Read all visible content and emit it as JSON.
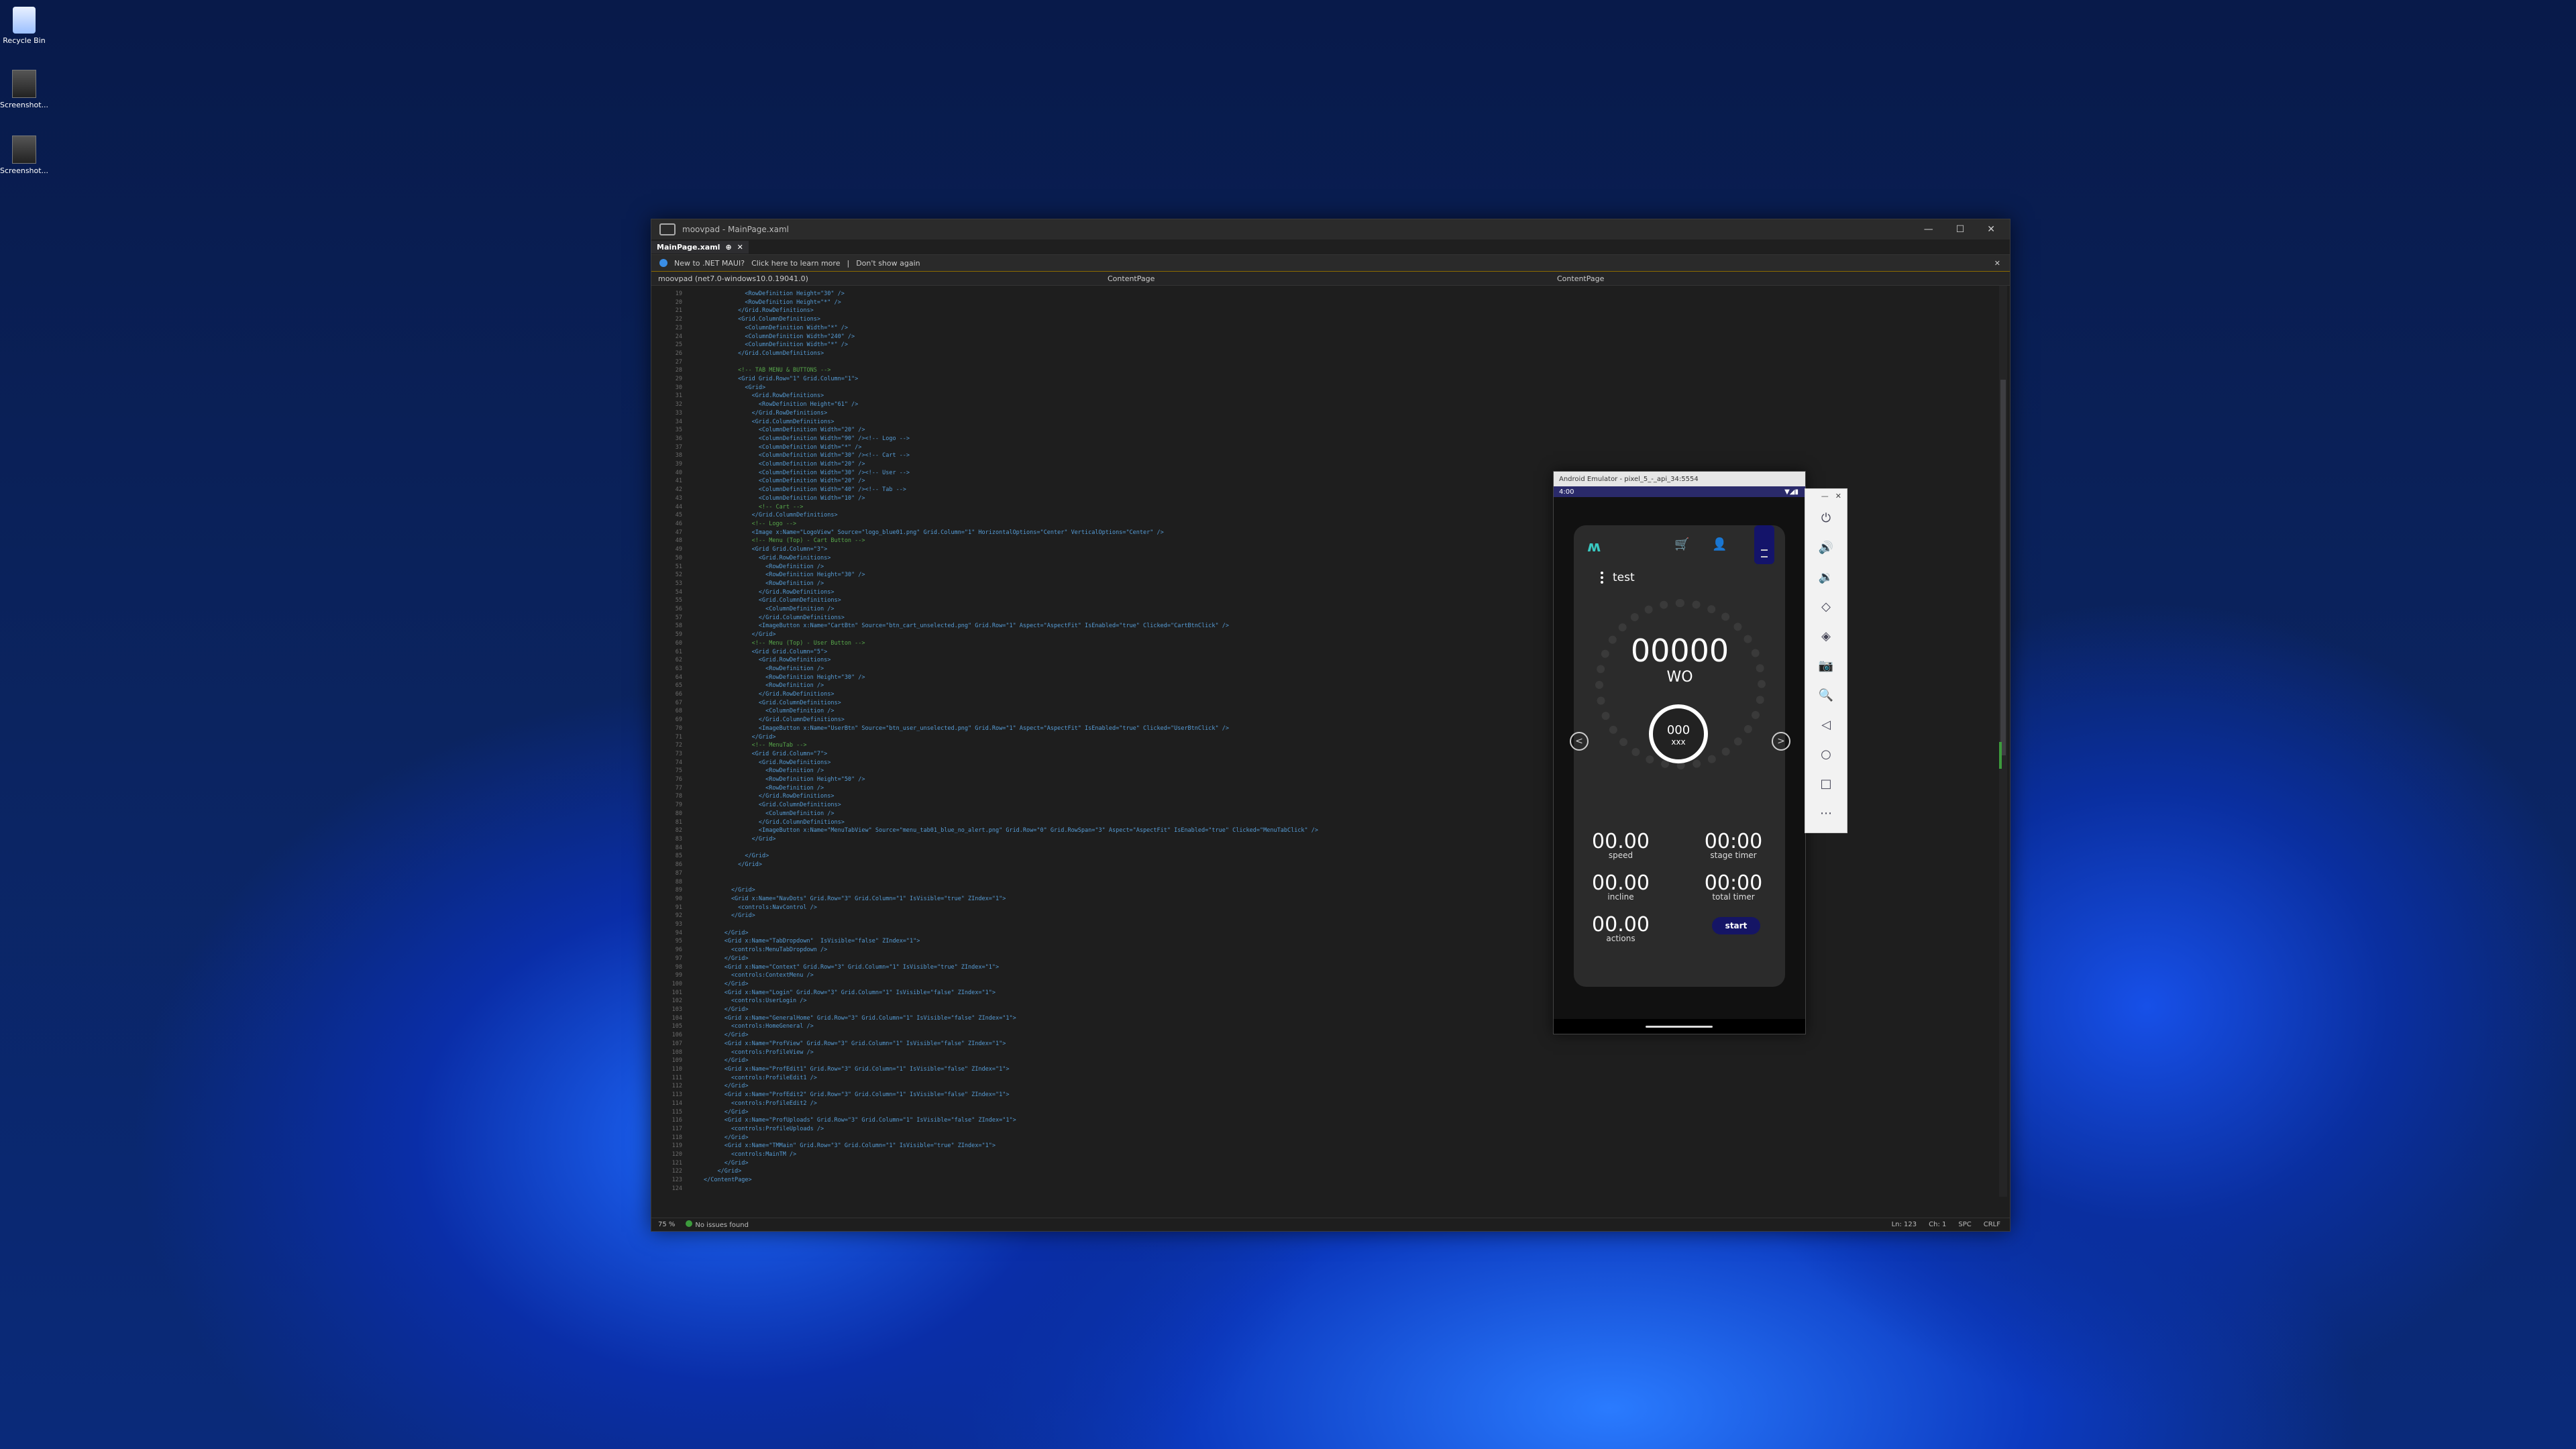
{
  "desktop": {
    "icons": [
      {
        "label": "Recycle Bin"
      },
      {
        "label": "Screenshot..."
      },
      {
        "label": "Screenshot..."
      }
    ]
  },
  "vs": {
    "window_title": "moovpad - MainPage.xaml",
    "tab_label": "MainPage.xaml",
    "tab_pin": "⊕",
    "tab_close": "✕",
    "info_text": "New to .NET MAUI?",
    "info_link": "Click here to learn more",
    "info_sep": "|",
    "info_dismiss": "Don't show again",
    "nav_project": "moovpad (net7.0-windows10.0.19041.0)",
    "nav_class": "ContentPage",
    "nav_member": "ContentPage",
    "zoom": "75 %",
    "issues": "No issues found",
    "ln": "Ln: 123",
    "ch": "Ch: 1",
    "spc": "SPC",
    "crlf": "CRLF",
    "line_numbers": [
      "19",
      "20",
      "21",
      "22",
      "23",
      "24",
      "25",
      "26",
      "27",
      "28",
      "29",
      "30",
      "31",
      "32",
      "33",
      "34",
      "35",
      "36",
      "37",
      "38",
      "39",
      "40",
      "41",
      "42",
      "43",
      "44",
      "45",
      "46",
      "47",
      "48",
      "49",
      "50",
      "51",
      "52",
      "53",
      "54",
      "55",
      "56",
      "57",
      "58",
      "59",
      "60",
      "61",
      "62",
      "63",
      "64",
      "65",
      "66",
      "67",
      "68",
      "69",
      "70",
      "71",
      "72",
      "73",
      "74",
      "75",
      "76",
      "77",
      "78",
      "79",
      "80",
      "81",
      "82",
      "83",
      "84",
      "85",
      "86",
      "87",
      "88",
      "89",
      "90",
      "91",
      "92",
      "93",
      "94",
      "95",
      "96",
      "97",
      "98",
      "99",
      "100",
      "101",
      "102",
      "103",
      "104",
      "105",
      "106",
      "107",
      "108",
      "109",
      "110",
      "111",
      "112",
      "113",
      "114",
      "115",
      "116",
      "117",
      "118",
      "119",
      "120",
      "121",
      "122",
      "123",
      "124"
    ],
    "code_lines": [
      "            <RowDefinition Height=\"30\" />",
      "            <RowDefinition Height=\"*\" />",
      "          </Grid.RowDefinitions>",
      "          <Grid.ColumnDefinitions>",
      "            <ColumnDefinition Width=\"*\" />",
      "            <ColumnDefinition Width=\"240\" />",
      "            <ColumnDefinition Width=\"*\" />",
      "          </Grid.ColumnDefinitions>",
      "",
      "          <!-- TAB MENU & BUTTONS -->",
      "          <Grid Grid.Row=\"1\" Grid.Column=\"1\">",
      "            <Grid>",
      "              <Grid.RowDefinitions>",
      "                <RowDefinition Height=\"61\" />",
      "              </Grid.RowDefinitions>",
      "              <Grid.ColumnDefinitions>",
      "                <ColumnDefinition Width=\"20\" />",
      "                <ColumnDefinition Width=\"90\" /><!-- Logo -->",
      "                <ColumnDefinition Width=\"*\" />",
      "                <ColumnDefinition Width=\"30\" /><!-- Cart -->",
      "                <ColumnDefinition Width=\"20\" />",
      "                <ColumnDefinition Width=\"30\" /><!-- User -->",
      "                <ColumnDefinition Width=\"20\" />",
      "                <ColumnDefinition Width=\"40\" /><!-- Tab -->",
      "                <ColumnDefinition Width=\"10\" />",
      "                <!-- Cart -->",
      "              </Grid.ColumnDefinitions>",
      "              <!-- Logo -->",
      "              <Image x:Name=\"LogoView\" Source=\"logo_blue01.png\" Grid.Column=\"1\" HorizontalOptions=\"Center\" VerticalOptions=\"Center\" />",
      "              <!-- Menu (Top) - Cart Button -->",
      "              <Grid Grid.Column=\"3\">",
      "                <Grid.RowDefinitions>",
      "                  <RowDefinition />",
      "                  <RowDefinition Height=\"30\" />",
      "                  <RowDefinition />",
      "                </Grid.RowDefinitions>",
      "                <Grid.ColumnDefinitions>",
      "                  <ColumnDefinition />",
      "                </Grid.ColumnDefinitions>",
      "                <ImageButton x:Name=\"CartBtn\" Source=\"btn_cart_unselected.png\" Grid.Row=\"1\" Aspect=\"AspectFit\" IsEnabled=\"true\" Clicked=\"CartBtnClick\" />",
      "              </Grid>",
      "              <!-- Menu (Top) - User Button -->",
      "              <Grid Grid.Column=\"5\">",
      "                <Grid.RowDefinitions>",
      "                  <RowDefinition />",
      "                  <RowDefinition Height=\"30\" />",
      "                  <RowDefinition />",
      "                </Grid.RowDefinitions>",
      "                <Grid.ColumnDefinitions>",
      "                  <ColumnDefinition />",
      "                </Grid.ColumnDefinitions>",
      "                <ImageButton x:Name=\"UserBtn\" Source=\"btn_user_unselected.png\" Grid.Row=\"1\" Aspect=\"AspectFit\" IsEnabled=\"true\" Clicked=\"UserBtnClick\" />",
      "              </Grid>",
      "              <!-- MenuTab -->",
      "              <Grid Grid.Column=\"7\">",
      "                <Grid.RowDefinitions>",
      "                  <RowDefinition />",
      "                  <RowDefinition Height=\"50\" />",
      "                  <RowDefinition />",
      "                </Grid.RowDefinitions>",
      "                <Grid.ColumnDefinitions>",
      "                  <ColumnDefinition />",
      "                </Grid.ColumnDefinitions>",
      "                <ImageButton x:Name=\"MenuTabView\" Source=\"menu_tab01_blue_no_alert.png\" Grid.Row=\"0\" Grid.RowSpan=\"3\" Aspect=\"AspectFit\" IsEnabled=\"true\" Clicked=\"MenuTabClick\" />",
      "              </Grid>",
      "",
      "            </Grid>",
      "          </Grid>",
      "",
      "",
      "        </Grid>",
      "        <Grid x:Name=\"NavDots\" Grid.Row=\"3\" Grid.Column=\"1\" IsVisible=\"true\" ZIndex=\"1\">",
      "          <controls:NavControl />",
      "        </Grid>",
      "",
      "      </Grid>",
      "      <Grid x:Name=\"TabDropdown\"  IsVisible=\"false\" ZIndex=\"1\">",
      "        <controls:MenuTabDropdown />",
      "      </Grid>",
      "      <Grid x:Name=\"Context\" Grid.Row=\"3\" Grid.Column=\"1\" IsVisible=\"true\" ZIndex=\"1\">",
      "        <controls:ContextMenu />",
      "      </Grid>",
      "      <Grid x:Name=\"Login\" Grid.Row=\"3\" Grid.Column=\"1\" IsVisible=\"false\" ZIndex=\"1\">",
      "        <controls:UserLogin />",
      "      </Grid>",
      "      <Grid x:Name=\"GeneralHome\" Grid.Row=\"3\" Grid.Column=\"1\" IsVisible=\"false\" ZIndex=\"1\">",
      "        <controls:HomeGeneral />",
      "      </Grid>",
      "      <Grid x:Name=\"ProfView\" Grid.Row=\"3\" Grid.Column=\"1\" IsVisible=\"false\" ZIndex=\"1\">",
      "        <controls:ProfileView />",
      "      </Grid>",
      "      <Grid x:Name=\"ProfEdit1\" Grid.Row=\"3\" Grid.Column=\"1\" IsVisible=\"false\" ZIndex=\"1\">",
      "        <controls:ProfileEdit1 />",
      "      </Grid>",
      "      <Grid x:Name=\"ProfEdit2\" Grid.Row=\"3\" Grid.Column=\"1\" IsVisible=\"false\" ZIndex=\"1\">",
      "        <controls:ProfileEdit2 />",
      "      </Grid>",
      "      <Grid x:Name=\"ProfUploads\" Grid.Row=\"3\" Grid.Column=\"1\" IsVisible=\"false\" ZIndex=\"1\">",
      "        <controls:ProfileUploads />",
      "      </Grid>",
      "      <Grid x:Name=\"TMMain\" Grid.Row=\"3\" Grid.Column=\"1\" IsVisible=\"true\" ZIndex=\"1\">",
      "        <controls:MainTM />",
      "      </Grid>",
      "    </Grid>",
      "</ContentPage>",
      ""
    ]
  },
  "emulator": {
    "title": "Android Emulator - pixel_5_-_api_34:5554",
    "time": "4:00",
    "status_icons": "▼◢▮",
    "logo": "ʍ",
    "cart_icon": "🛒",
    "user_icon": "👤",
    "user_name": "test",
    "main_value": "00000",
    "main_unit": "WO",
    "inner_value": "000",
    "inner_unit": "xxx",
    "left_arrow": "<",
    "right_arrow": ">",
    "metrics": [
      {
        "value": "00.00",
        "label": "speed"
      },
      {
        "value": "00:00",
        "label": "stage timer"
      },
      {
        "value": "00.00",
        "label": "incline"
      },
      {
        "value": "00:00",
        "label": "total timer"
      },
      {
        "value": "00.00",
        "label": "actions"
      }
    ],
    "start_label": "start",
    "tools": [
      "⏻",
      "🔊",
      "🔉",
      "◇",
      "◈",
      "📷",
      "🔍",
      "◁",
      "○",
      "□",
      "⋯"
    ],
    "win_min": "—",
    "win_close": "✕"
  }
}
